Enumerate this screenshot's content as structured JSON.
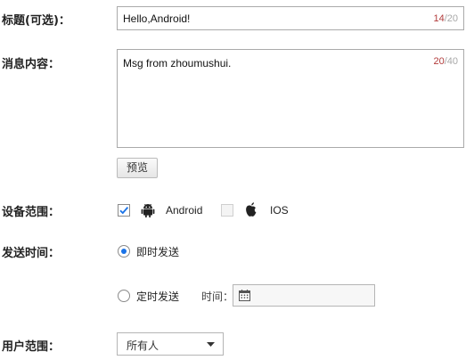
{
  "title_field": {
    "label": "标题(可选)：",
    "value": "Hello,Android!",
    "count": "14",
    "max": "/20"
  },
  "message_field": {
    "label": "消息内容：",
    "value": "Msg from zhoumushui.",
    "count": "20",
    "max": "/40"
  },
  "preview_button": {
    "label": "预览"
  },
  "device_scope": {
    "label": "设备范围：",
    "options": [
      {
        "label": "Android",
        "checked": true,
        "icon": "android-icon"
      },
      {
        "label": "IOS",
        "checked": false,
        "icon": "apple-icon"
      }
    ]
  },
  "send_time": {
    "label": "发送时间：",
    "options": [
      {
        "label": "即时发送",
        "selected": true
      },
      {
        "label": "定时发送",
        "selected": false
      }
    ],
    "time_label": "时间："
  },
  "user_scope": {
    "label": "用户范围：",
    "selected": "所有人"
  },
  "colors": {
    "accent": "#1a73e8",
    "count_current": "#b23b3b",
    "count_max": "#a8a8a8"
  }
}
